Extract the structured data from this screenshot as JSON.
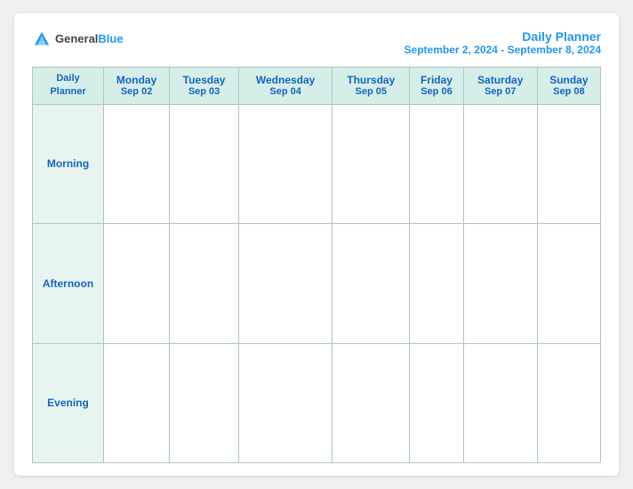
{
  "header": {
    "logo_general": "General",
    "logo_blue": "Blue",
    "title_main": "Daily Planner",
    "title_sub": "September 2, 2024 - September 8, 2024"
  },
  "table": {
    "label_header": [
      "Daily",
      "Planner"
    ],
    "days": [
      {
        "name": "Monday",
        "date": "Sep 02"
      },
      {
        "name": "Tuesday",
        "date": "Sep 03"
      },
      {
        "name": "Wednesday",
        "date": "Sep 04"
      },
      {
        "name": "Thursday",
        "date": "Sep 05"
      },
      {
        "name": "Friday",
        "date": "Sep 06"
      },
      {
        "name": "Saturday",
        "date": "Sep 07"
      },
      {
        "name": "Sunday",
        "date": "Sep 08"
      }
    ],
    "time_slots": [
      "Morning",
      "Afternoon",
      "Evening"
    ]
  }
}
